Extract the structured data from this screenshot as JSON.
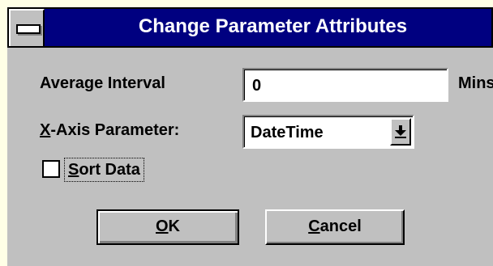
{
  "window": {
    "title": "Change Parameter Attributes"
  },
  "form": {
    "average_interval_label": "Average Interval",
    "average_interval_value": "0",
    "average_interval_unit": "Mins",
    "xaxis_label_mnemonic": "X",
    "xaxis_label_rest": "-Axis Parameter:",
    "xaxis_value": "DateTime",
    "sort_mnemonic": "S",
    "sort_rest": "ort Data",
    "sort_checked": false
  },
  "buttons": {
    "ok_mnemonic": "O",
    "ok_rest": "K",
    "cancel_mnemonic": "C",
    "cancel_rest": "ancel"
  },
  "icons": {
    "system_menu": "system-menu-icon",
    "dropdown_arrow": "dropdown-arrow-icon"
  },
  "colors": {
    "titlebar": "#000080",
    "face": "#c0c0c0",
    "outer_frame": "#ffffe6"
  }
}
